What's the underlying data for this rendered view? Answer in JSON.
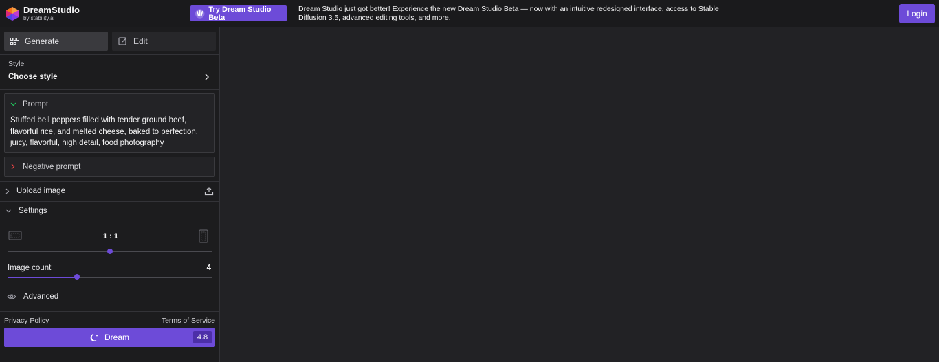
{
  "brand": {
    "title": "DreamStudio",
    "subtitle": "by stability.ai"
  },
  "header": {
    "beta_button": "Try Dream Studio Beta",
    "announcement": "Dream Studio just got better! Experience the new Dream Studio Beta — now with an intuitive redesigned interface, access to Stable Diffusion 3.5, advanced editing tools, and more.",
    "login": "Login"
  },
  "modes": {
    "generate": "Generate",
    "edit": "Edit"
  },
  "style": {
    "label": "Style",
    "value": "Choose style"
  },
  "prompt": {
    "label": "Prompt",
    "text": "Stuffed bell peppers filled with tender ground beef, flavorful rice, and melted cheese, baked to perfection, juicy, flavorful, high detail, food photography"
  },
  "negative_prompt": {
    "label": "Negative prompt"
  },
  "upload": {
    "label": "Upload image"
  },
  "settings": {
    "label": "Settings",
    "aspect_ratio": "1 : 1",
    "aspect_ratio_position": 0.5,
    "image_count_label": "Image count",
    "image_count": "4",
    "image_count_position": 0.34,
    "advanced": "Advanced"
  },
  "footer": {
    "privacy": "Privacy Policy",
    "terms": "Terms of Service",
    "dream": "Dream",
    "cost": "4.8"
  },
  "colors": {
    "accent": "#6d4bd8",
    "background": "#222225",
    "sidebar": "#1c1c1e"
  }
}
